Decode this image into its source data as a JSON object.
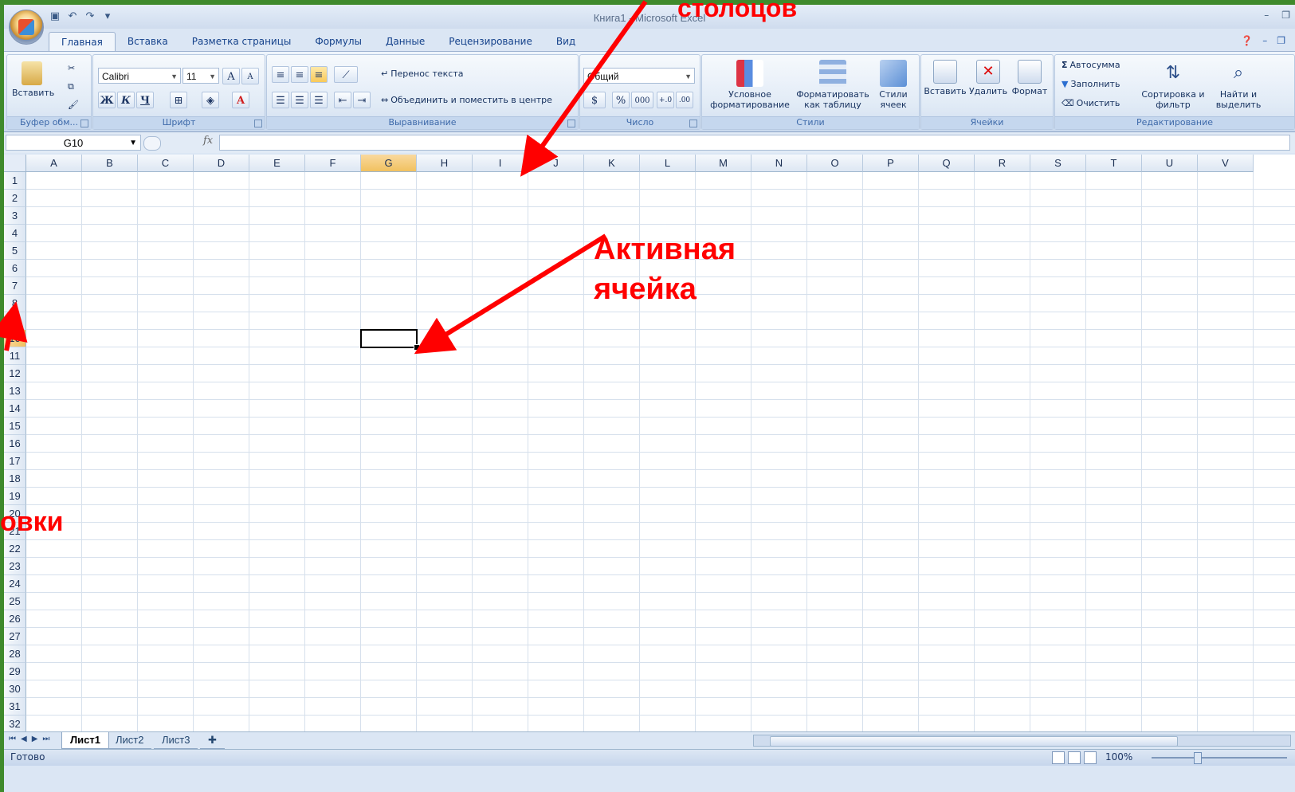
{
  "window": {
    "title": "Книга1 - Microsoft Excel"
  },
  "tabs": [
    "Главная",
    "Вставка",
    "Разметка страницы",
    "Формулы",
    "Данные",
    "Рецензирование",
    "Вид"
  ],
  "ribbon": {
    "clipboard": {
      "paste": "Вставить",
      "label": "Буфер обм..."
    },
    "font": {
      "name": "Calibri",
      "size": "11",
      "bold": "Ж",
      "italic": "К",
      "underline": "Ч",
      "label": "Шрифт"
    },
    "alignment": {
      "wrap": "Перенос текста",
      "merge": "Объединить и поместить в центре",
      "label": "Выравнивание"
    },
    "number": {
      "format": "Общий",
      "percent": "%",
      "thousands": "000",
      "label": "Число"
    },
    "styles": {
      "conditional": "Условное форматирование",
      "as_table": "Форматировать как таблицу",
      "cell_styles": "Стили ячеек",
      "label": "Стили"
    },
    "cells": {
      "insert": "Вставить",
      "delete": "Удалить",
      "format": "Формат",
      "label": "Ячейки"
    },
    "editing": {
      "autosum": "Автосумма",
      "fill": "Заполнить",
      "clear": "Очистить",
      "sort": "Сортировка и фильтр",
      "find": "Найти и выделить",
      "label": "Редактирование"
    }
  },
  "formula_bar": {
    "name_box": "G10",
    "fx": "fx",
    "value": ""
  },
  "grid": {
    "columns": [
      "A",
      "B",
      "C",
      "D",
      "E",
      "F",
      "G",
      "H",
      "I",
      "J",
      "K",
      "L",
      "M",
      "N",
      "O",
      "P",
      "Q",
      "R",
      "S",
      "T",
      "U",
      "V"
    ],
    "rows": [
      "1",
      "2",
      "3",
      "4",
      "5",
      "6",
      "7",
      "8",
      "9",
      "10",
      "11",
      "12",
      "13",
      "14",
      "15",
      "16",
      "17",
      "18",
      "19",
      "20",
      "21",
      "22",
      "23",
      "24",
      "25",
      "26",
      "27",
      "28",
      "29",
      "30",
      "31",
      "32"
    ],
    "active_cell": "G10",
    "active_col": "G",
    "active_row": "10"
  },
  "sheets": [
    "Лист1",
    "Лист2",
    "Лист3"
  ],
  "active_sheet": "Лист1",
  "status": {
    "text": "Готово",
    "zoom": "100%"
  },
  "annotations": {
    "top": "столоцов",
    "active": "Активная ячейка",
    "left": "овки"
  },
  "colors": {
    "annotation": "#ff0000",
    "active_header": "#f1c15f"
  }
}
